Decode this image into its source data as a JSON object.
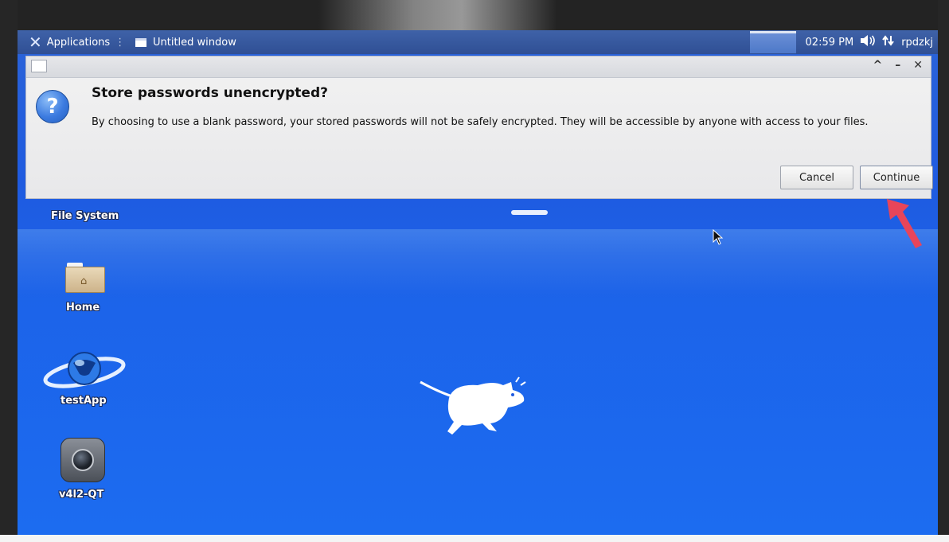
{
  "panel": {
    "applications_label": "Applications",
    "taskbar_window": "Untitled window",
    "clock": "02:59 PM",
    "username": "rpdzkj"
  },
  "dialog": {
    "heading": "Store passwords unencrypted?",
    "message": "By choosing to use a blank password, your stored passwords will not be safely encrypted. They will be accessible by anyone with access to your files.",
    "cancel_label": "Cancel",
    "continue_label": "Continue"
  },
  "desktop": {
    "icons": [
      {
        "label": "File System"
      },
      {
        "label": "Home"
      },
      {
        "label": "testApp"
      },
      {
        "label": "v4l2-QT"
      }
    ]
  },
  "colors": {
    "desktop_blue": "#1f5be0",
    "panel_blue": "#3f62a8",
    "annotation_red": "#e8455a"
  }
}
